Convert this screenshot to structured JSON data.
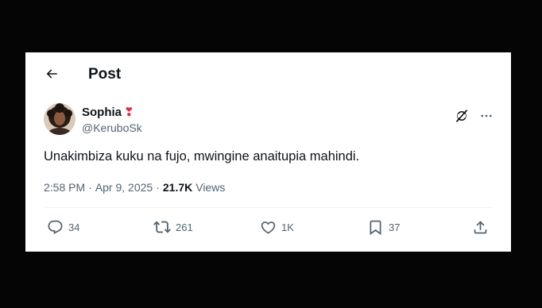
{
  "header": {
    "title": "Post",
    "back_icon": "arrow-left-icon"
  },
  "post": {
    "author_name": "Sophia",
    "author_emoji": "❣",
    "handle": "@KeruboSk",
    "text": "Unakimbiza kuku na fujo, mwingine anaitupia mahindi.",
    "time": "2:58 PM",
    "separator1": "·",
    "date": "Apr 9, 2025",
    "separator2": "·",
    "views_count": "21.7K",
    "views_label": "Views"
  },
  "actions": {
    "replies": "34",
    "reposts": "261",
    "likes": "1K",
    "bookmarks": "37"
  },
  "colors": {
    "text_primary": "#0f1419",
    "text_secondary": "#536471",
    "divider": "#eff3f4",
    "heart_emoji": "#dd2e44",
    "background": "#050505"
  }
}
